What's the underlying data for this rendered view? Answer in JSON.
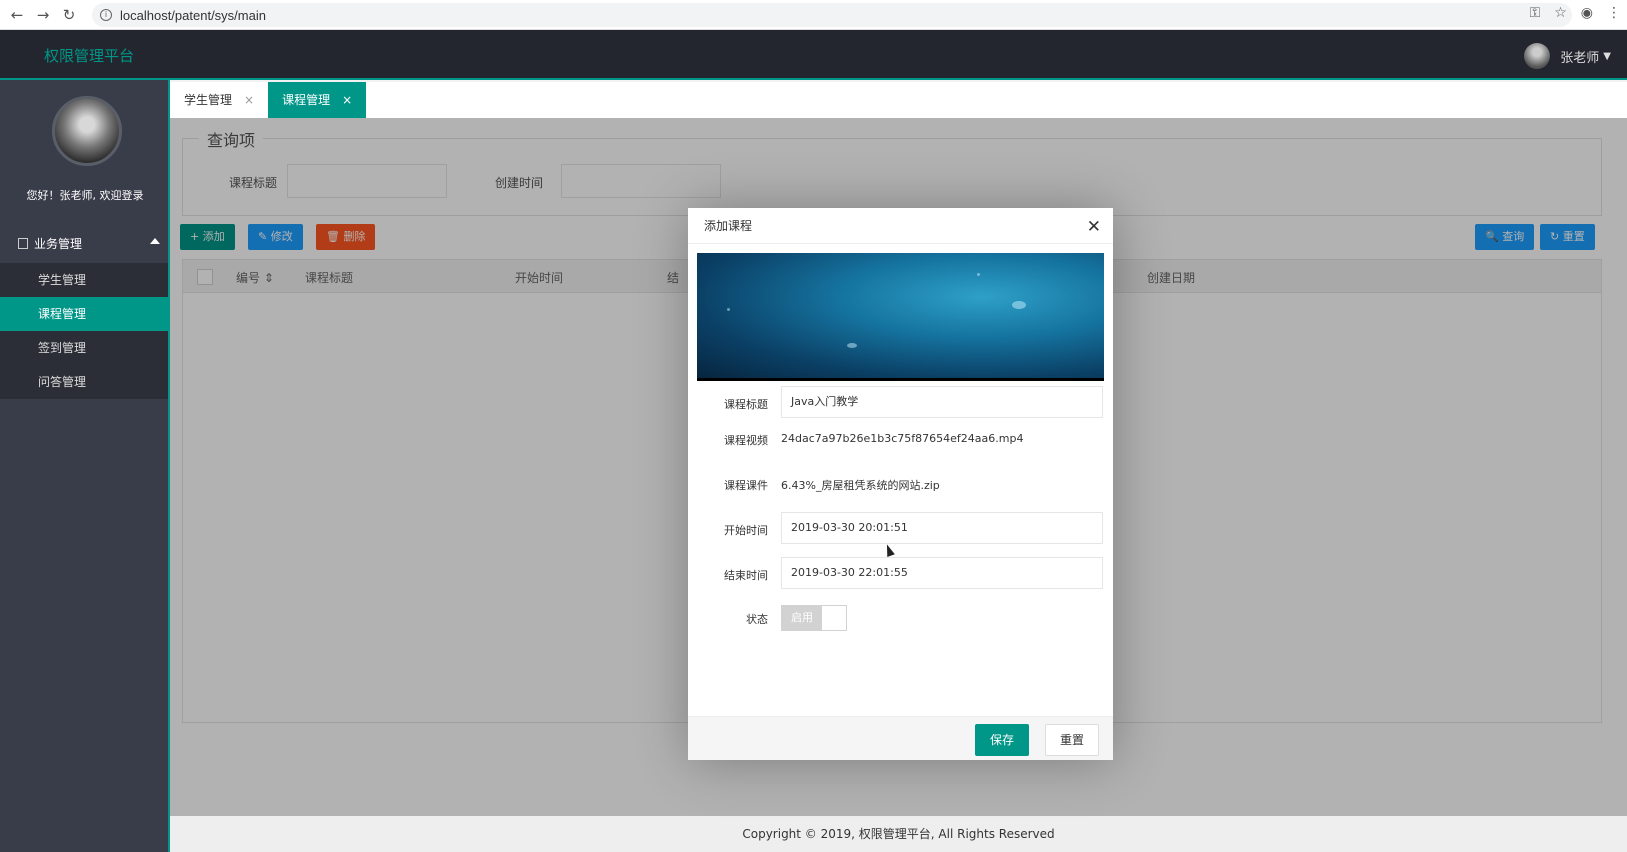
{
  "browser": {
    "url": "localhost/patent/sys/main"
  },
  "header": {
    "brand": "权限管理平台",
    "user_name": "张老师"
  },
  "sidebar": {
    "welcome": "您好！张老师, 欢迎登录",
    "group_label": "业务管理",
    "items": [
      {
        "label": "学生管理"
      },
      {
        "label": "课程管理"
      },
      {
        "label": "签到管理"
      },
      {
        "label": "问答管理"
      }
    ]
  },
  "tabs": [
    {
      "label": "学生管理",
      "close": "×"
    },
    {
      "label": "课程管理",
      "close": "×"
    }
  ],
  "query": {
    "legend": "查询项",
    "title_label": "课程标题",
    "date_label": "创建时间"
  },
  "toolbar": {
    "add": "+ 添加",
    "edit": "✎ 修改",
    "delete": "🗑 删除",
    "search": "🔍 查询",
    "reset": "↻ 重置"
  },
  "table": {
    "columns": [
      "编号 ⇕",
      "课程标题",
      "开始时间",
      "结",
      "创建日期"
    ]
  },
  "footer": {
    "copyright": "Copyright © 2019, 权限管理平台, All Rights Reserved"
  },
  "modal": {
    "title": "添加课程",
    "close": "✕",
    "fields": {
      "title_label": "课程标题",
      "title_value": "Java入门教学",
      "video_label": "课程视频",
      "video_value": "24dac7a97b26e1b3c75f87654ef24aa6.mp4",
      "ware_label": "课程课件",
      "ware_value": "6.43%_房屋租凭系统的网站.zip",
      "start_label": "开始时间",
      "start_value": "2019-03-30 20:01:51",
      "end_label": "结束时间",
      "end_value": "2019-03-30 22:01:55",
      "status_label": "状态",
      "status_value": "启用"
    },
    "save": "保存",
    "reset": "重置"
  },
  "colors": {
    "accent": "#009688",
    "header_bg": "#23262e",
    "sidebar_bg": "#393d49"
  }
}
